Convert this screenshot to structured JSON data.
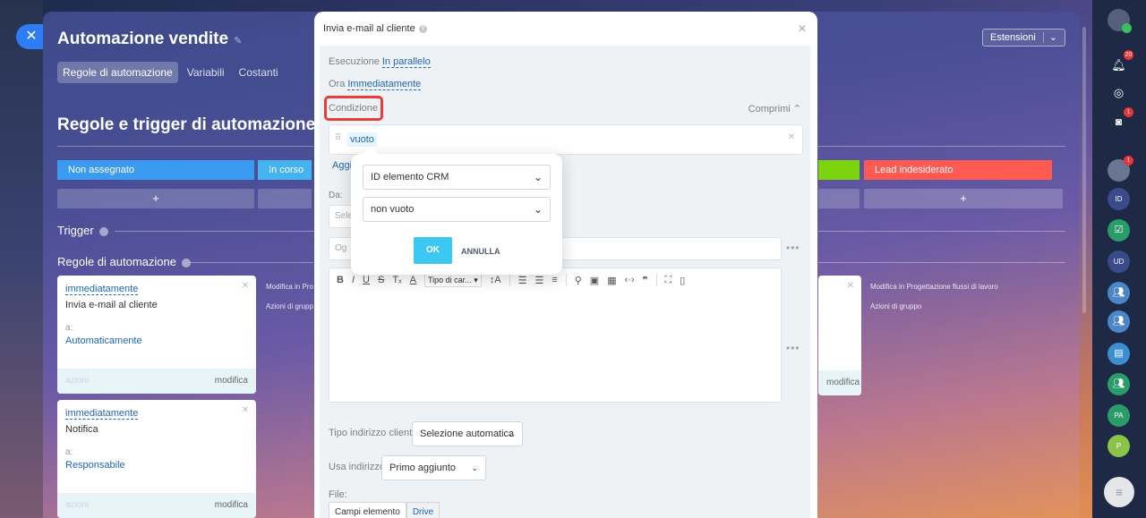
{
  "background_page": {
    "title": "Automazione vendite",
    "tabs": [
      "Regole di automazione",
      "Variabili",
      "Costanti"
    ],
    "extensions_label": "Estensioni",
    "section_title": "Regole e trigger di automazione",
    "stages": [
      {
        "label": "Non assegnato",
        "color": "#3a9bf0"
      },
      {
        "label": "In corso",
        "color": "#45b3f0"
      },
      {
        "label": "",
        "color": "#7bd40e"
      },
      {
        "label": "Lead indesiderato",
        "color": "#ff5a52"
      }
    ],
    "add_label": "+",
    "trigger_label": "Trigger",
    "rules_label": "Regole di automazione",
    "cards": [
      {
        "when": "immediatamente",
        "name": "Invia e-mail al cliente",
        "to_label": "a:",
        "who": "Automaticamente",
        "left_action": "azioni",
        "right_action": "modifica"
      },
      {
        "when": "immediatamente",
        "name": "Notifica",
        "to_label": "a:",
        "who": "Responsabile",
        "left_action": "azioni",
        "right_action": "modifica"
      }
    ],
    "side_links": {
      "modify_left": "Modifica in Pro",
      "group_left": "Azioni di grupp",
      "modify_right": "Modifica in Progettazione flussi di lavoro",
      "group_right": "Azioni di gruppo",
      "modifica_right": "modifica"
    }
  },
  "modal": {
    "title": "Invia e-mail al cliente",
    "execution_label": "Esecuzione",
    "execution_value": "In parallelo",
    "time_label": "Ora",
    "time_value": "Immediatamente",
    "condition_label": "Condizione",
    "collapse_label": "Comprimi",
    "condition_chip": "vuoto",
    "add_label": "Aggi",
    "from_label": "Da:",
    "from_placeholder": "Sele",
    "subject_placeholder": "Og",
    "toolbar_font": "Tipo di car...",
    "address_type_label": "Tipo indirizzo cliente:",
    "address_type_value": "Selezione automatica",
    "use_address_label": "Usa indirizzo:",
    "use_address_value": "Primo aggiunto",
    "file_label": "File:",
    "file_tabs": [
      "Campi elemento",
      "Drive"
    ]
  },
  "popup": {
    "field_value": "ID elemento CRM",
    "operator_value": "non vuoto",
    "ok_label": "OK",
    "cancel_label": "ANNULLA"
  },
  "right_sidebar": {
    "notification_count": "20",
    "chat_count": "1",
    "avatar_count": "1",
    "items": [
      "ID",
      "UD",
      "PA",
      "P"
    ]
  }
}
